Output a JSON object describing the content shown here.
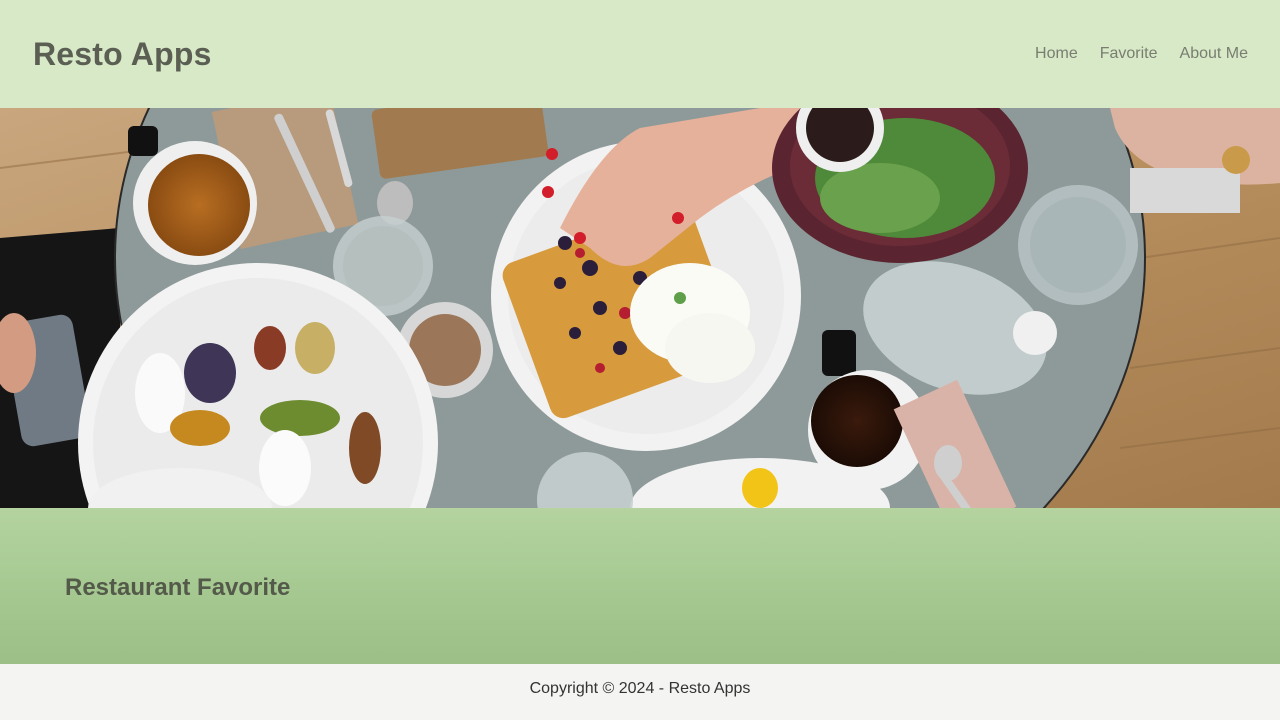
{
  "header": {
    "brand": "Resto Apps",
    "nav": [
      {
        "label": "Home"
      },
      {
        "label": "Favorite"
      },
      {
        "label": "About Me"
      }
    ]
  },
  "hero": {
    "image": "hero-image (restaurant table with waffles, coffee and salad)"
  },
  "main": {
    "title": "Restaurant Favorite"
  },
  "footer": {
    "copyright": "Copyright © 2024 - Resto Apps"
  },
  "colors": {
    "header_bg": "#d7e9c7",
    "content_bg": "#a6c992",
    "footer_bg": "#f4f4f3",
    "brand_text": "#5b5e52",
    "nav_text": "#7a7d70"
  }
}
